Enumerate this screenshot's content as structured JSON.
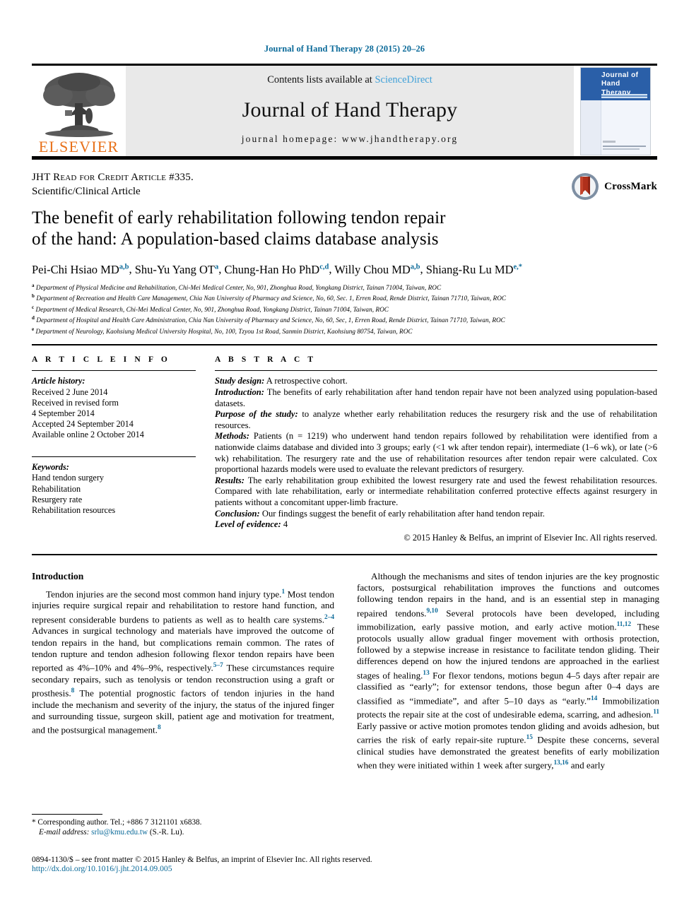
{
  "running_head": "Journal of Hand Therapy 28 (2015) 20–26",
  "masthead": {
    "contents_prefix": "Contents lists available at ",
    "contents_link": "ScienceDirect",
    "journal_title": "Journal of Hand Therapy",
    "homepage": "journal homepage: www.jhandtherapy.org",
    "publisher": "ELSEVIER",
    "cover_title_line1": "Journal of",
    "cover_title_line2": "Hand Therapy"
  },
  "article": {
    "jht_credit": "JHT Read for Credit Article #335.",
    "article_type": "Scientific/Clinical Article",
    "title_line1": "The benefit of early rehabilitation following tendon repair",
    "title_line2": "of the hand: A population-based claims database analysis",
    "crossmark_label": "CrossMark",
    "authors": [
      {
        "name": "Pei-Chi Hsiao MD",
        "sup": "a,b",
        "sep": ", "
      },
      {
        "name": "Shu-Yu Yang OT",
        "sup": "a",
        "sep": ", "
      },
      {
        "name": "Chung-Han Ho PhD",
        "sup": "c,d",
        "sep": ", "
      },
      {
        "name": "Willy Chou MD",
        "sup": "a,b",
        "sep": ", "
      },
      {
        "name": "Shiang-Ru Lu MD",
        "sup": "e,*",
        "sep": ""
      }
    ],
    "affiliations": [
      {
        "mark": "a",
        "text": "Department of Physical Medicine and Rehabilitation, Chi-Mei Medical Center, No, 901, Zhonghua Road, Yongkang District, Tainan 71004, Taiwan, ROC"
      },
      {
        "mark": "b",
        "text": "Department of Recreation and Health Care Management, Chia Nan University of Pharmacy and Science, No, 60, Sec. 1, Erren Road, Rende District, Tainan 71710, Taiwan, ROC"
      },
      {
        "mark": "c",
        "text": "Department of Medical Research, Chi-Mei Medical Center, No, 901, Zhonghua Road, Yongkang District, Tainan 71004, Taiwan, ROC"
      },
      {
        "mark": "d",
        "text": "Department of Hospital and Health Care Administration, Chia Nan University of Pharmacy and Science, No, 60, Sec, 1, Erren Road, Rende District, Tainan 71710, Taiwan, ROC"
      },
      {
        "mark": "e",
        "text": "Department of Neurology, Kaohsiung Medical University Hospital, No, 100, Tzyou 1st Road, Sanmin District, Kaohsiung 80754, Taiwan, ROC"
      }
    ]
  },
  "article_info": {
    "heading": "A R T I C L E   I N F O",
    "history_label": "Article history:",
    "history": [
      "Received 2 June 2014",
      "Received in revised form",
      "4 September 2014",
      "Accepted 24 September 2014",
      "Available online 2 October 2014"
    ],
    "keywords_label": "Keywords:",
    "keywords": [
      "Hand tendon surgery",
      "Rehabilitation",
      "Resurgery rate",
      "Rehabilitation resources"
    ]
  },
  "abstract": {
    "heading": "A B S T R A C T",
    "sections": [
      {
        "label": "Study design:",
        "text": " A retrospective cohort."
      },
      {
        "label": "Introduction:",
        "text": " The benefits of early rehabilitation after hand tendon repair have not been analyzed using population-based datasets."
      },
      {
        "label": "Purpose of the study:",
        "text": " to analyze whether early rehabilitation reduces the resurgery risk and the use of rehabilitation resources."
      },
      {
        "label": "Methods:",
        "text": " Patients (n = 1219) who underwent hand tendon repairs followed by rehabilitation were identified from a nationwide claims database and divided into 3 groups; early (<1 wk after tendon repair), intermediate (1–6 wk), or late (>6 wk) rehabilitation. The resurgery rate and the use of rehabilitation resources after tendon repair were calculated. Cox proportional hazards models were used to evaluate the relevant predictors of resurgery."
      },
      {
        "label": "Results:",
        "text": " The early rehabilitation group exhibited the lowest resurgery rate and used the fewest rehabilitation resources. Compared with late rehabilitation, early or intermediate rehabilitation conferred protective effects against resurgery in patients without a concomitant upper-limb fracture."
      },
      {
        "label": "Conclusion:",
        "text": " Our findings suggest the benefit of early rehabilitation after hand tendon repair."
      },
      {
        "label": "Level of evidence:",
        "text": " 4"
      }
    ],
    "copyright": "© 2015 Hanley & Belfus, an imprint of Elsevier Inc. All rights reserved."
  },
  "body": {
    "left_heading": "Introduction",
    "left_paragraph_1": "Tendon injuries are the second most common hand injury type.",
    "left_p1_ref1": "1",
    "left_p1_b": " Most tendon injuries require surgical repair and rehabilitation to restore hand function, and represent considerable burdens to patients as well as to health care systems.",
    "left_p1_ref2": "2–4",
    "left_p1_c": " Advances in surgical technology and materials have improved the outcome of tendon repairs in the hand, but complications remain common. The rates of tendon rupture and tendon adhesion following flexor tendon repairs have been reported as 4%–10% and 4%–9%, respectively.",
    "left_p1_ref3": "5–7",
    "left_p1_d": " These circumstances require secondary repairs, such as tenolysis or tendon reconstruction using a graft or prosthesis.",
    "left_p1_ref4": "8",
    "left_p1_e": " The potential prognostic factors of tendon injuries in the hand include the mechanism and severity of the injury, the status of the injured finger and surrounding tissue, surgeon skill, patient age and motivation for treatment, and the postsurgical management.",
    "left_p1_ref5": "8",
    "right_a": "Although the mechanisms and sites of tendon injuries are the key prognostic factors, postsurgical rehabilitation improves the functions and outcomes following tendon repairs in the hand, and is an essential step in managing repaired tendons.",
    "right_ref1": "9,10",
    "right_b": " Several protocols have been developed, including immobilization, early passive motion, and early active motion.",
    "right_ref2": "11,12",
    "right_c": " These protocols usually allow gradual finger movement with orthosis protection, followed by a stepwise increase in resistance to facilitate tendon gliding. Their differences depend on how the injured tendons are approached in the earliest stages of healing.",
    "right_ref3": "13",
    "right_d": " For flexor tendons, motions begun 4–5 days after repair are classified as “early”; for extensor tendons, those begun after 0–4 days are classified as “immediate”, and after 5–10 days as “early.”",
    "right_ref4": "14",
    "right_e": " Immobilization protects the repair site at the cost of undesirable edema, scarring, and adhesion.",
    "right_ref5": "11",
    "right_f": " Early passive or active motion promotes tendon gliding and avoids adhesion, but carries the risk of early repair-site rupture.",
    "right_ref6": "15",
    "right_g": " Despite these concerns, several clinical studies have demonstrated the greatest benefits of early mobilization when they were initiated within 1 week after surgery,",
    "right_ref7": "13,16",
    "right_h": " and early"
  },
  "footnote": {
    "corresponding": "* Corresponding author. Tel.; +886 7 3121101 x6838.",
    "email_label": "E-mail address:",
    "email": "srlu@kmu.edu.tw",
    "email_suffix": " (S.-R. Lu)."
  },
  "footer": {
    "line1": "0894-1130/$ – see front matter © 2015 Hanley & Belfus, an imprint of Elsevier Inc. All rights reserved.",
    "doi": "http://dx.doi.org/10.1016/j.jht.2014.09.005"
  },
  "colors": {
    "link_blue": "#0b6a99",
    "sciencedirect_blue": "#3fa0d8",
    "elsevier_orange": "#E8711A",
    "cover_blue": "#2a5fa8",
    "crossmark_red": "#B0301B"
  }
}
